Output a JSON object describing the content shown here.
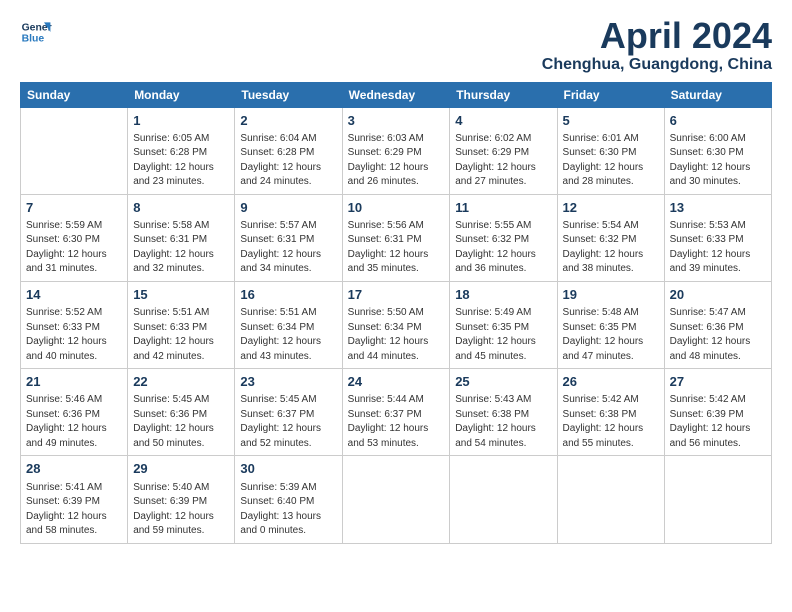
{
  "header": {
    "logo_line1": "General",
    "logo_line2": "Blue",
    "month_year": "April 2024",
    "location": "Chenghua, Guangdong, China"
  },
  "days_of_week": [
    "Sunday",
    "Monday",
    "Tuesday",
    "Wednesday",
    "Thursday",
    "Friday",
    "Saturday"
  ],
  "weeks": [
    [
      {
        "num": "",
        "info": ""
      },
      {
        "num": "1",
        "info": "Sunrise: 6:05 AM\nSunset: 6:28 PM\nDaylight: 12 hours\nand 23 minutes."
      },
      {
        "num": "2",
        "info": "Sunrise: 6:04 AM\nSunset: 6:28 PM\nDaylight: 12 hours\nand 24 minutes."
      },
      {
        "num": "3",
        "info": "Sunrise: 6:03 AM\nSunset: 6:29 PM\nDaylight: 12 hours\nand 26 minutes."
      },
      {
        "num": "4",
        "info": "Sunrise: 6:02 AM\nSunset: 6:29 PM\nDaylight: 12 hours\nand 27 minutes."
      },
      {
        "num": "5",
        "info": "Sunrise: 6:01 AM\nSunset: 6:30 PM\nDaylight: 12 hours\nand 28 minutes."
      },
      {
        "num": "6",
        "info": "Sunrise: 6:00 AM\nSunset: 6:30 PM\nDaylight: 12 hours\nand 30 minutes."
      }
    ],
    [
      {
        "num": "7",
        "info": "Sunrise: 5:59 AM\nSunset: 6:30 PM\nDaylight: 12 hours\nand 31 minutes."
      },
      {
        "num": "8",
        "info": "Sunrise: 5:58 AM\nSunset: 6:31 PM\nDaylight: 12 hours\nand 32 minutes."
      },
      {
        "num": "9",
        "info": "Sunrise: 5:57 AM\nSunset: 6:31 PM\nDaylight: 12 hours\nand 34 minutes."
      },
      {
        "num": "10",
        "info": "Sunrise: 5:56 AM\nSunset: 6:31 PM\nDaylight: 12 hours\nand 35 minutes."
      },
      {
        "num": "11",
        "info": "Sunrise: 5:55 AM\nSunset: 6:32 PM\nDaylight: 12 hours\nand 36 minutes."
      },
      {
        "num": "12",
        "info": "Sunrise: 5:54 AM\nSunset: 6:32 PM\nDaylight: 12 hours\nand 38 minutes."
      },
      {
        "num": "13",
        "info": "Sunrise: 5:53 AM\nSunset: 6:33 PM\nDaylight: 12 hours\nand 39 minutes."
      }
    ],
    [
      {
        "num": "14",
        "info": "Sunrise: 5:52 AM\nSunset: 6:33 PM\nDaylight: 12 hours\nand 40 minutes."
      },
      {
        "num": "15",
        "info": "Sunrise: 5:51 AM\nSunset: 6:33 PM\nDaylight: 12 hours\nand 42 minutes."
      },
      {
        "num": "16",
        "info": "Sunrise: 5:51 AM\nSunset: 6:34 PM\nDaylight: 12 hours\nand 43 minutes."
      },
      {
        "num": "17",
        "info": "Sunrise: 5:50 AM\nSunset: 6:34 PM\nDaylight: 12 hours\nand 44 minutes."
      },
      {
        "num": "18",
        "info": "Sunrise: 5:49 AM\nSunset: 6:35 PM\nDaylight: 12 hours\nand 45 minutes."
      },
      {
        "num": "19",
        "info": "Sunrise: 5:48 AM\nSunset: 6:35 PM\nDaylight: 12 hours\nand 47 minutes."
      },
      {
        "num": "20",
        "info": "Sunrise: 5:47 AM\nSunset: 6:36 PM\nDaylight: 12 hours\nand 48 minutes."
      }
    ],
    [
      {
        "num": "21",
        "info": "Sunrise: 5:46 AM\nSunset: 6:36 PM\nDaylight: 12 hours\nand 49 minutes."
      },
      {
        "num": "22",
        "info": "Sunrise: 5:45 AM\nSunset: 6:36 PM\nDaylight: 12 hours\nand 50 minutes."
      },
      {
        "num": "23",
        "info": "Sunrise: 5:45 AM\nSunset: 6:37 PM\nDaylight: 12 hours\nand 52 minutes."
      },
      {
        "num": "24",
        "info": "Sunrise: 5:44 AM\nSunset: 6:37 PM\nDaylight: 12 hours\nand 53 minutes."
      },
      {
        "num": "25",
        "info": "Sunrise: 5:43 AM\nSunset: 6:38 PM\nDaylight: 12 hours\nand 54 minutes."
      },
      {
        "num": "26",
        "info": "Sunrise: 5:42 AM\nSunset: 6:38 PM\nDaylight: 12 hours\nand 55 minutes."
      },
      {
        "num": "27",
        "info": "Sunrise: 5:42 AM\nSunset: 6:39 PM\nDaylight: 12 hours\nand 56 minutes."
      }
    ],
    [
      {
        "num": "28",
        "info": "Sunrise: 5:41 AM\nSunset: 6:39 PM\nDaylight: 12 hours\nand 58 minutes."
      },
      {
        "num": "29",
        "info": "Sunrise: 5:40 AM\nSunset: 6:39 PM\nDaylight: 12 hours\nand 59 minutes."
      },
      {
        "num": "30",
        "info": "Sunrise: 5:39 AM\nSunset: 6:40 PM\nDaylight: 13 hours\nand 0 minutes."
      },
      {
        "num": "",
        "info": ""
      },
      {
        "num": "",
        "info": ""
      },
      {
        "num": "",
        "info": ""
      },
      {
        "num": "",
        "info": ""
      }
    ]
  ]
}
